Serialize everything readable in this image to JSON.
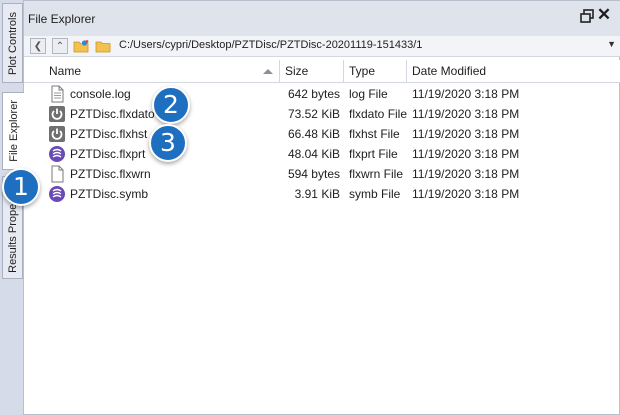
{
  "side_tabs": {
    "plot_controls": "Plot Controls",
    "file_explorer": "File Explorer",
    "results_properties": "Results Properties"
  },
  "window": {
    "title": "File Explorer"
  },
  "toolbar": {
    "path": "C:/Users/cypri/Desktop/PZTDisc/PZTDisc-20201119-151433/1"
  },
  "columns": {
    "name": "Name",
    "size": "Size",
    "type": "Type",
    "date": "Date Modified"
  },
  "files": [
    {
      "name": "console.log",
      "size": "642 bytes",
      "type": "log File",
      "date": "11/19/2020 3:18 PM",
      "icon": "document-icon"
    },
    {
      "name": "PZTDisc.flxdato",
      "size": "73.52 KiB",
      "type": "flxdato File",
      "date": "11/19/2020 3:18 PM",
      "icon": "power-icon"
    },
    {
      "name": "PZTDisc.flxhst",
      "size": "66.48 KiB",
      "type": "flxhst File",
      "date": "11/19/2020 3:18 PM",
      "icon": "power-icon"
    },
    {
      "name": "PZTDisc.flxprt",
      "size": "48.04 KiB",
      "type": "flxprt File",
      "date": "11/19/2020 3:18 PM",
      "icon": "purple-logo-icon"
    },
    {
      "name": "PZTDisc.flxwrn",
      "size": "594 bytes",
      "type": "flxwrn File",
      "date": "11/19/2020 3:18 PM",
      "icon": "blank-document-icon"
    },
    {
      "name": "PZTDisc.symb",
      "size": "3.91 KiB",
      "type": "symb File",
      "date": "11/19/2020 3:18 PM",
      "icon": "purple-logo-icon"
    }
  ],
  "callouts": {
    "one": "1",
    "two": "2",
    "three": "3"
  },
  "colors": {
    "badge": "#1f6fc0",
    "tab_strip": "#d6dbe9",
    "titlebar": "#dfe3ec",
    "purple_logo": "#6a4bb5"
  }
}
